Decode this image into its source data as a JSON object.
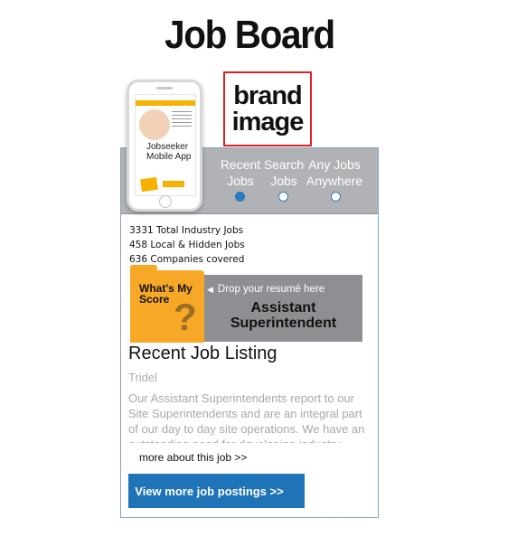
{
  "header": {
    "title": "Job Board",
    "brand_line1": "brand",
    "brand_line2": "image"
  },
  "phone": {
    "app_line1": "Jobseeker",
    "app_line2": "Mobile App"
  },
  "tabs": [
    {
      "line1": "Recent",
      "line2": "Jobs",
      "selected": true
    },
    {
      "line1": "Search",
      "line2": "Jobs",
      "selected": false
    },
    {
      "line1": "Any Jobs",
      "line2": "Anywhere",
      "selected": false
    }
  ],
  "stats": {
    "total": "3331 Total Industry Jobs",
    "local": "458 Local & Hidden Jobs",
    "companies": "636 Companies covered"
  },
  "resume": {
    "score_line1": "What's My",
    "score_line2": "Score",
    "question_mark": "?",
    "drop_label": "Drop your resumé here",
    "job_line1": "Assistant",
    "job_line2": "Superintendent"
  },
  "listing": {
    "title": "Recent Job Listing",
    "company": "Tridel",
    "description": "Our Assistant Superintendents report to our Site Superintendents and are an integral part of our day to day site operations. We have an outstanding need for developing industry"
  },
  "actions": {
    "more_link": "more about this job >>",
    "view_button": "View more job postings >>"
  },
  "colors": {
    "accent_blue": "#1f73b7",
    "folder_orange": "#f7a826",
    "topbar_gray": "#b1b2b5",
    "brand_border": "#e0201f"
  }
}
